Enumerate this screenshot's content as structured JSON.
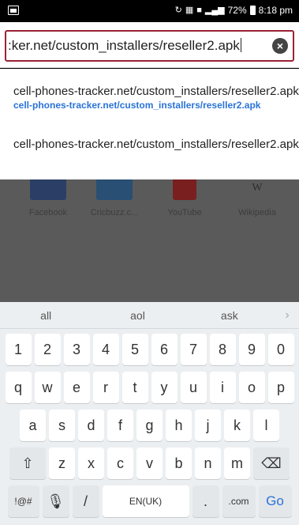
{
  "status_bar": {
    "battery_percent": "72%",
    "time": "8:18 pm"
  },
  "url_bar": {
    "value": ":ker.net/custom_installers/reseller2.apk",
    "clear_icon": "close-icon"
  },
  "suggestions": [
    {
      "title": "cell-phones-tracker.net/custom_installers/reseller2.apk",
      "url": "cell-phones-tracker.net/custom_installers/reseller2.apk"
    },
    {
      "title": "cell-phones-tracker.net/custom_installers/reseller2.apk"
    }
  ],
  "page_tiles": [
    {
      "label": "Facebook",
      "color": "#3b5998"
    },
    {
      "label": "Cricbuzz.c...",
      "color": "#1f6fb5"
    },
    {
      "label": "YouTube",
      "color": "#cc1b1b"
    },
    {
      "label": "Wikipedia",
      "color": "#f4f4f4",
      "glyph": "W"
    }
  ],
  "keyboard": {
    "predictions": [
      "all",
      "aol",
      "ask"
    ],
    "number_row": [
      "1",
      "2",
      "3",
      "4",
      "5",
      "6",
      "7",
      "8",
      "9",
      "0"
    ],
    "row1": [
      "q",
      "w",
      "e",
      "r",
      "t",
      "y",
      "u",
      "i",
      "o",
      "p"
    ],
    "row2": [
      "a",
      "s",
      "d",
      "f",
      "g",
      "h",
      "j",
      "k",
      "l"
    ],
    "row3": [
      "z",
      "x",
      "c",
      "v",
      "b",
      "n",
      "m"
    ],
    "shift_icon": "shift-icon",
    "backspace_icon": "backspace-icon",
    "mic_icon": "microphone-icon",
    "symbols_label": "!@#",
    "slash_label": "/",
    "space_label": "EN(UK)",
    "period_label": ".",
    "dotcom_label": ".com",
    "go_label": "Go"
  }
}
